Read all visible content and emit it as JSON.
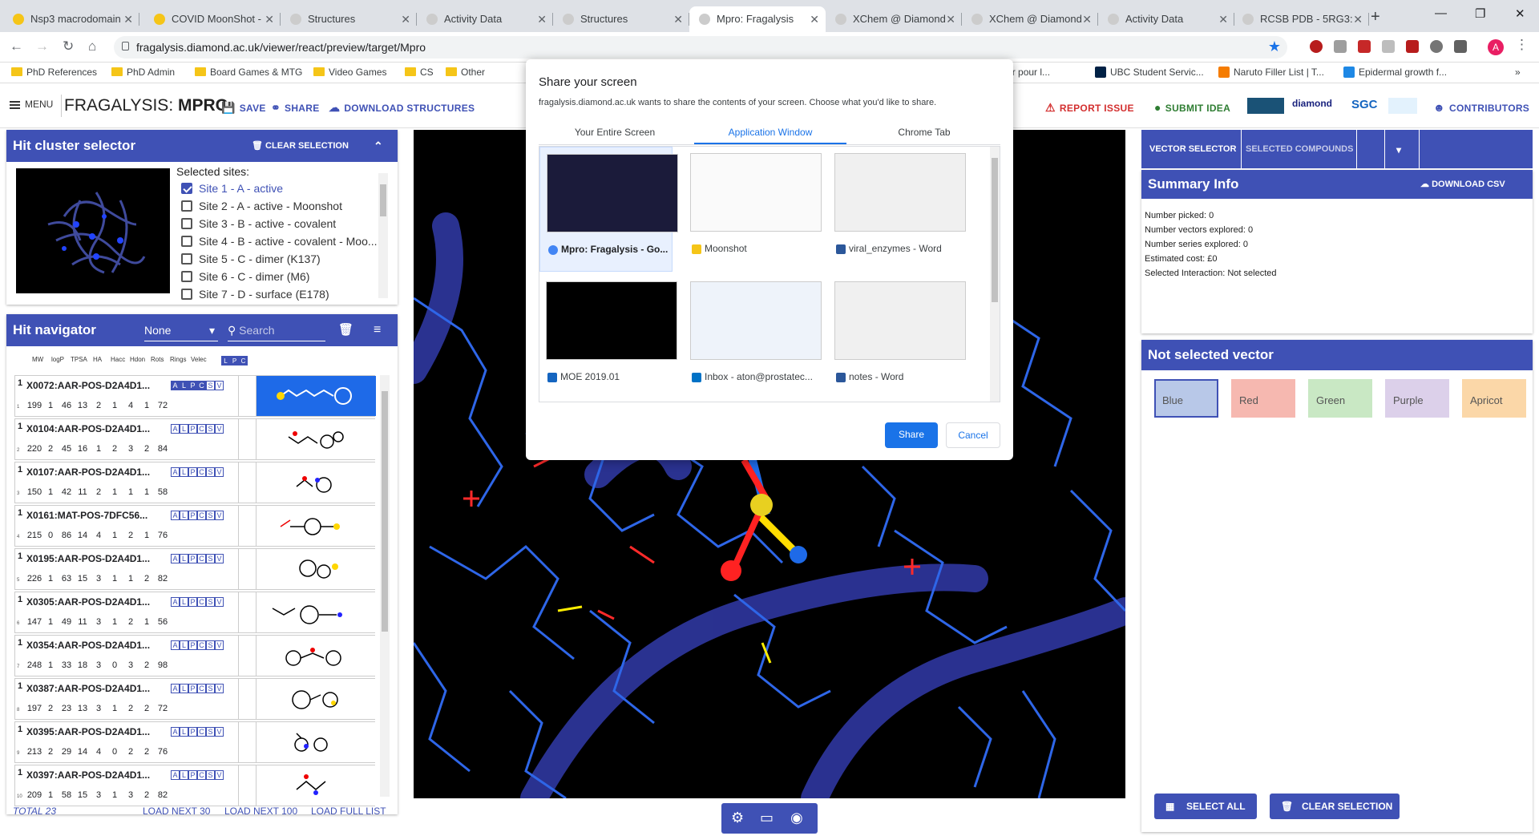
{
  "browser": {
    "tabs": [
      {
        "label": "Nsp3 macrodomain",
        "active": false
      },
      {
        "label": "COVID MoonShot -",
        "active": false
      },
      {
        "label": "Structures",
        "active": false
      },
      {
        "label": "Activity Data",
        "active": false
      },
      {
        "label": "Structures",
        "active": false
      },
      {
        "label": "Mpro: Fragalysis",
        "active": true
      },
      {
        "label": "XChem @ Diamond",
        "active": false
      },
      {
        "label": "XChem @ Diamond",
        "active": false
      },
      {
        "label": "Activity Data",
        "active": false
      },
      {
        "label": "RCSB PDB - 5RG3:",
        "active": false
      }
    ],
    "url": "fragalysis.diamond.ac.uk/viewer/react/preview/target/Mpro",
    "bookmarks": [
      "PhD References",
      "PhD Admin",
      "Board Games & MTG",
      "Video Games",
      "CS",
      "Other",
      "dossier pour l...",
      "UBC Student Servic...",
      "Naruto Filler List | T...",
      "Epidermal growth f..."
    ],
    "profile_initial": "A"
  },
  "header": {
    "menu_label": "MENU",
    "title_prefix": "FRAGALYSIS: ",
    "title_target": "MPRO",
    "save": "SAVE",
    "share": "SHARE",
    "download": "DOWNLOAD STRUCTURES",
    "report": "REPORT ISSUE",
    "submit": "SUBMIT IDEA",
    "contributors": "CONTRIBUTORS",
    "logos": [
      "diamond",
      "SGC"
    ]
  },
  "hit_cluster": {
    "title": "Hit cluster selector",
    "clear": "CLEAR SELECTION",
    "selected_label": "Selected sites:",
    "sites": [
      {
        "label": "Site 1 - A - active",
        "checked": true
      },
      {
        "label": "Site 2 - A - active - Moonshot",
        "checked": false
      },
      {
        "label": "Site 3 - B - active - covalent",
        "checked": false
      },
      {
        "label": "Site 4 - B - active - covalent - Moo...",
        "checked": false
      },
      {
        "label": "Site 5 - C - dimer (K137)",
        "checked": false
      },
      {
        "label": "Site 6 - C - dimer (M6)",
        "checked": false
      },
      {
        "label": "Site 7 - D - surface (E178)",
        "checked": false
      }
    ]
  },
  "hit_nav": {
    "title": "Hit navigator",
    "filter_value": "None",
    "search_placeholder": "Search",
    "columns": [
      "MW",
      "logP",
      "TPSA",
      "HA",
      "Hacc",
      "Hdon",
      "Rots",
      "Rings",
      "Velec"
    ],
    "lpc": [
      "L",
      "P",
      "C"
    ],
    "rows": [
      {
        "idx": "1",
        "n": "1",
        "name": "X0072:AAR-POS-D2A4D1...",
        "props": [
          "199",
          "1",
          "46",
          "13",
          "2",
          "1",
          "4",
          "1",
          "72"
        ],
        "selected": true
      },
      {
        "idx": "1",
        "n": "2",
        "name": "X0104:AAR-POS-D2A4D1...",
        "props": [
          "220",
          "2",
          "45",
          "16",
          "1",
          "2",
          "3",
          "2",
          "84"
        ],
        "selected": false
      },
      {
        "idx": "1",
        "n": "3",
        "name": "X0107:AAR-POS-D2A4D1...",
        "props": [
          "150",
          "1",
          "42",
          "11",
          "2",
          "1",
          "1",
          "1",
          "58"
        ],
        "selected": false
      },
      {
        "idx": "1",
        "n": "4",
        "name": "X0161:MAT-POS-7DFC56...",
        "props": [
          "215",
          "0",
          "86",
          "14",
          "4",
          "1",
          "2",
          "1",
          "76"
        ],
        "selected": false
      },
      {
        "idx": "1",
        "n": "5",
        "name": "X0195:AAR-POS-D2A4D1...",
        "props": [
          "226",
          "1",
          "63",
          "15",
          "3",
          "1",
          "1",
          "2",
          "82"
        ],
        "selected": false
      },
      {
        "idx": "1",
        "n": "6",
        "name": "X0305:AAR-POS-D2A4D1...",
        "props": [
          "147",
          "1",
          "49",
          "11",
          "3",
          "1",
          "2",
          "1",
          "56"
        ],
        "selected": false
      },
      {
        "idx": "1",
        "n": "7",
        "name": "X0354:AAR-POS-D2A4D1...",
        "props": [
          "248",
          "1",
          "33",
          "18",
          "3",
          "0",
          "3",
          "2",
          "98"
        ],
        "selected": false
      },
      {
        "idx": "1",
        "n": "8",
        "name": "X0387:AAR-POS-D2A4D1...",
        "props": [
          "197",
          "2",
          "23",
          "13",
          "3",
          "1",
          "2",
          "2",
          "72"
        ],
        "selected": false
      },
      {
        "idx": "1",
        "n": "9",
        "name": "X0395:AAR-POS-D2A4D1...",
        "props": [
          "213",
          "2",
          "29",
          "14",
          "4",
          "0",
          "2",
          "2",
          "76"
        ],
        "selected": false
      },
      {
        "idx": "1",
        "n": "10",
        "name": "X0397:AAR-POS-D2A4D1...",
        "props": [
          "209",
          "1",
          "58",
          "15",
          "3",
          "1",
          "3",
          "2",
          "82"
        ],
        "selected": false
      }
    ],
    "tags": [
      "A",
      "L",
      "P",
      "C",
      "S",
      "V"
    ],
    "total": "TOTAL 23",
    "load_30": "LOAD NEXT 30",
    "load_100": "LOAD NEXT 100",
    "load_full": "LOAD FULL LIST"
  },
  "dialog": {
    "title": "Share your screen",
    "subtitle": "fragalysis.diamond.ac.uk wants to share the contents of your screen. Choose what you'd like to share.",
    "tabs": [
      "Your Entire Screen",
      "Application Window",
      "Chrome Tab"
    ],
    "windows": [
      {
        "label": "Mpro: Fragalysis - Go...",
        "icon_color": "#4285f4"
      },
      {
        "label": "Moonshot",
        "icon_color": "#f5c518"
      },
      {
        "label": "viral_enzymes - Word",
        "icon_color": "#2b579a"
      },
      {
        "label": "MOE 2019.01",
        "icon_color": "#1565c0"
      },
      {
        "label": "Inbox - aton@prostatec...",
        "icon_color": "#0072c6"
      },
      {
        "label": "notes - Word",
        "icon_color": "#2b579a"
      }
    ],
    "share": "Share",
    "cancel": "Cancel"
  },
  "right": {
    "tab_vector": "VECTOR SELECTOR",
    "tab_selected": "SELECTED COMPOUNDS",
    "summary_title": "Summary Info",
    "download_csv": "DOWNLOAD CSV",
    "summary_lines": [
      "Number picked: 0",
      "Number vectors explored: 0",
      "Number series explored: 0",
      "Estimated cost: £0",
      "Selected Interaction: Not selected"
    ],
    "not_selected_title": "Not selected vector",
    "colors": [
      {
        "label": "Blue",
        "bg": "#b8c8e8",
        "border": "#3f51b5"
      },
      {
        "label": "Red",
        "bg": "#f6b8b0",
        "border": "#f6b8b0"
      },
      {
        "label": "Green",
        "bg": "#c9e8c4",
        "border": "#c9e8c4"
      },
      {
        "label": "Purple",
        "bg": "#dcd0ea",
        "border": "#dcd0ea"
      },
      {
        "label": "Apricot",
        "bg": "#fbd7a8",
        "border": "#fbd7a8"
      }
    ],
    "select_all": "SELECT ALL",
    "clear_selection": "CLEAR SELECTION"
  }
}
